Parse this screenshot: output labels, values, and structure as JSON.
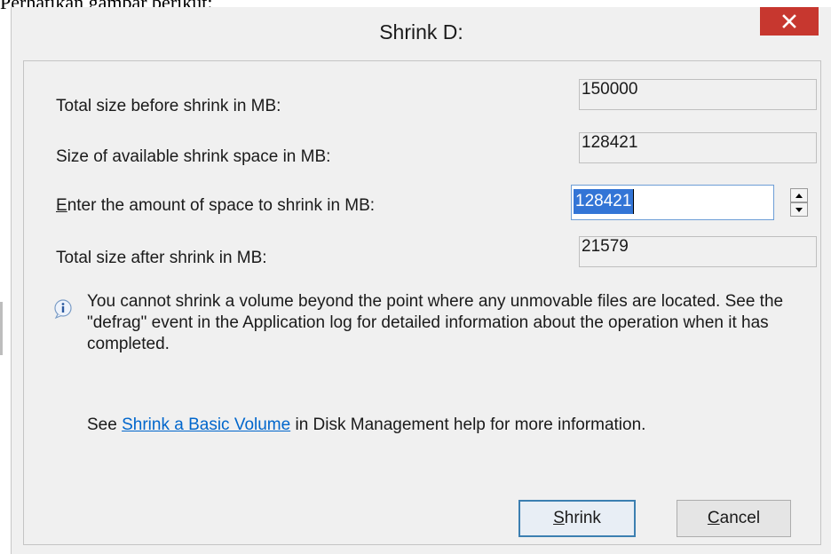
{
  "background_text": "Perhatikan gambar berikut:",
  "window": {
    "title": "Shrink D:",
    "close_icon": "close-x-icon"
  },
  "fields": {
    "total_before": {
      "label": "Total size before shrink in MB:",
      "value": "150000"
    },
    "available": {
      "label": "Size of available shrink space in MB:",
      "value": "128421"
    },
    "amount": {
      "label_mnemonic": "E",
      "label_rest": "nter the amount of space to shrink in MB:",
      "value": "128421"
    },
    "total_after": {
      "label": "Total size after shrink in MB:",
      "value": "21579"
    }
  },
  "info": {
    "icon": "info-icon",
    "text": "You cannot shrink a volume beyond the point where any unmovable files are located. See the \"defrag\" event in the Application log for detailed information about the operation when it has completed."
  },
  "help": {
    "prefix": "See ",
    "link": "Shrink a Basic Volume",
    "suffix": " in Disk Management help for more information."
  },
  "buttons": {
    "shrink": {
      "mnemonic": "S",
      "rest": "hrink"
    },
    "cancel": {
      "mnemonic": "C",
      "rest": "ancel"
    }
  },
  "colors": {
    "close_button": "#c7372f",
    "selection": "#3375d6",
    "link": "#0066cc"
  }
}
